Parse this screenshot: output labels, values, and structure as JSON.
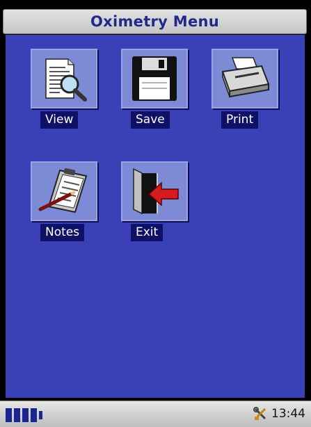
{
  "window": {
    "title": "Oximetry Menu"
  },
  "menu": {
    "items": [
      {
        "label": "View",
        "icon": "document-magnifier-icon"
      },
      {
        "label": "Save",
        "icon": "floppy-disk-icon"
      },
      {
        "label": "Print",
        "icon": "printer-icon"
      },
      {
        "label": "Notes",
        "icon": "clipboard-pen-icon"
      },
      {
        "label": "Exit",
        "icon": "exit-door-arrow-icon"
      }
    ]
  },
  "status": {
    "time": "13:44",
    "battery_cells": 4
  },
  "colors": {
    "background": "#3a40b6",
    "title_text": "#1f2a8a",
    "label_bg": "#0f1168",
    "icon_bg": "#7d8ad6"
  }
}
